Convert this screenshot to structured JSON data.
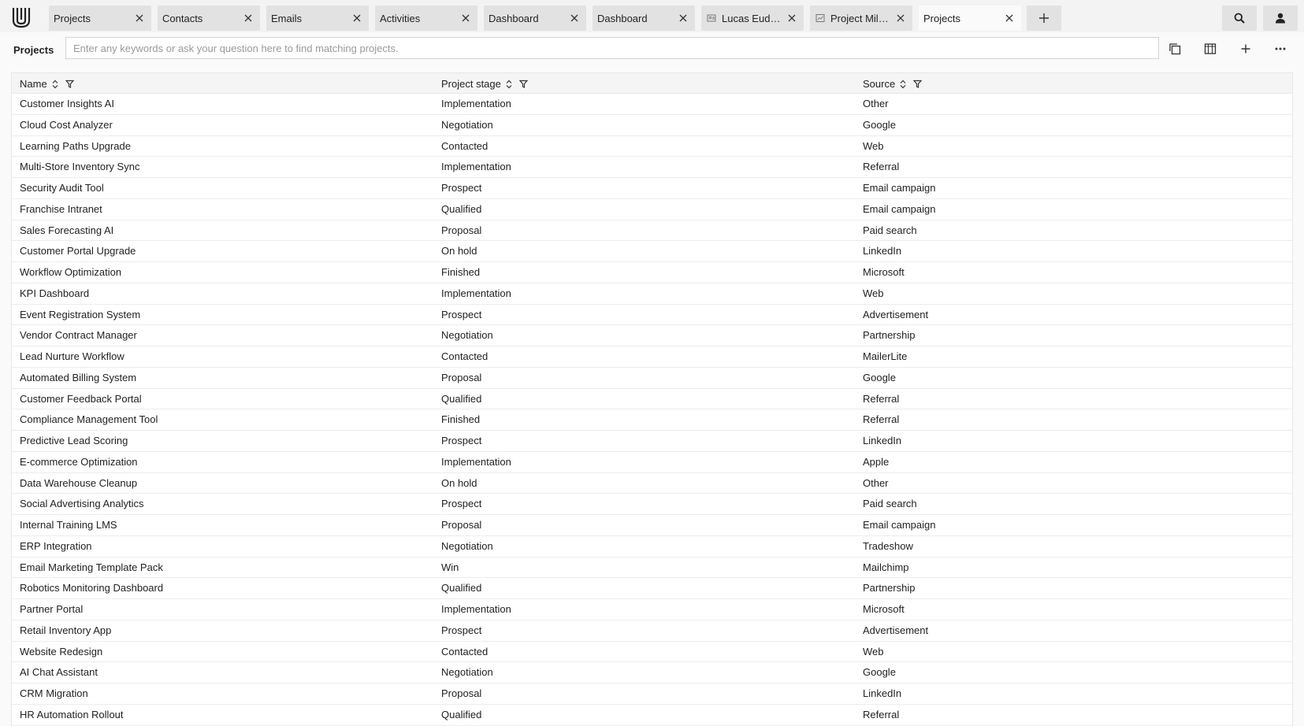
{
  "tabs": [
    {
      "label": "Projects",
      "icon": null
    },
    {
      "label": "Contacts",
      "icon": null
    },
    {
      "label": "Emails",
      "icon": null
    },
    {
      "label": "Activities",
      "icon": null
    },
    {
      "label": "Dashboard",
      "icon": null
    },
    {
      "label": "Dashboard",
      "icon": null
    },
    {
      "label": "Lucas Eudora…",
      "icon": "contact-card-icon"
    },
    {
      "label": "Project Milest…",
      "icon": "chart-icon"
    },
    {
      "label": "Projects",
      "icon": null,
      "active": true
    }
  ],
  "header": {
    "title": "Projects",
    "search_placeholder": "Enter any keywords or ask your question here to find matching projects."
  },
  "table": {
    "columns": [
      "Name",
      "Project stage",
      "Source"
    ],
    "rows": [
      [
        "Customer Insights AI",
        "Implementation",
        "Other"
      ],
      [
        "Cloud Cost Analyzer",
        "Negotiation",
        "Google"
      ],
      [
        "Learning Paths Upgrade",
        "Contacted",
        "Web"
      ],
      [
        "Multi-Store Inventory Sync",
        "Implementation",
        "Referral"
      ],
      [
        "Security Audit Tool",
        "Prospect",
        "Email campaign"
      ],
      [
        "Franchise Intranet",
        "Qualified",
        "Email campaign"
      ],
      [
        "Sales Forecasting AI",
        "Proposal",
        "Paid search"
      ],
      [
        "Customer Portal Upgrade",
        "On hold",
        "LinkedIn"
      ],
      [
        "Workflow Optimization",
        "Finished",
        "Microsoft"
      ],
      [
        "KPI Dashboard",
        "Implementation",
        "Web"
      ],
      [
        "Event Registration System",
        "Prospect",
        "Advertisement"
      ],
      [
        "Vendor Contract Manager",
        "Negotiation",
        "Partnership"
      ],
      [
        "Lead Nurture Workflow",
        "Contacted",
        "MailerLite"
      ],
      [
        "Automated Billing System",
        "Proposal",
        "Google"
      ],
      [
        "Customer Feedback Portal",
        "Qualified",
        "Referral"
      ],
      [
        "Compliance Management Tool",
        "Finished",
        "Referral"
      ],
      [
        "Predictive Lead Scoring",
        "Prospect",
        "LinkedIn"
      ],
      [
        "E-commerce Optimization",
        "Implementation",
        "Apple"
      ],
      [
        "Data Warehouse Cleanup",
        "On hold",
        "Other"
      ],
      [
        "Social Advertising Analytics",
        "Prospect",
        "Paid search"
      ],
      [
        "Internal Training LMS",
        "Proposal",
        "Email campaign"
      ],
      [
        "ERP Integration",
        "Negotiation",
        "Tradeshow"
      ],
      [
        "Email Marketing Template Pack",
        "Win",
        "Mailchimp"
      ],
      [
        "Robotics Monitoring Dashboard",
        "Qualified",
        "Partnership"
      ],
      [
        "Partner Portal",
        "Implementation",
        "Microsoft"
      ],
      [
        "Retail Inventory App",
        "Prospect",
        "Advertisement"
      ],
      [
        "Website Redesign",
        "Contacted",
        "Web"
      ],
      [
        "AI Chat Assistant",
        "Negotiation",
        "Google"
      ],
      [
        "CRM Migration",
        "Proposal",
        "LinkedIn"
      ],
      [
        "HR Automation Rollout",
        "Qualified",
        "Referral"
      ]
    ]
  }
}
